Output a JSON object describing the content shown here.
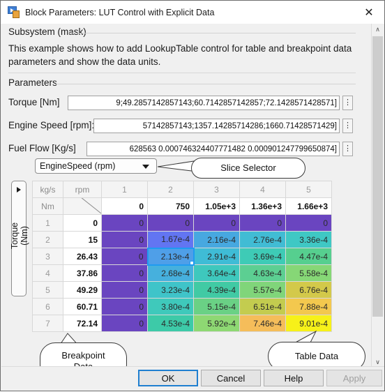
{
  "window": {
    "title": "Block Parameters: LUT Control with Explicit Data",
    "icon": "simulink-block-icon",
    "close_label": "✕"
  },
  "mask": {
    "type_label": "Subsystem (mask)",
    "description": "This example shows how to add LookupTable control for table and breakpoint data  parameters and show the data units.",
    "parameters_heading": "Parameters"
  },
  "parameters": [
    {
      "label": "Torque [Nm]",
      "value": "9;49.2857142857143;60.7142857142857;72.1428571428571]",
      "menu_icon": "⋮"
    },
    {
      "label": "Engine Speed [rpm]:",
      "value": "57142857143;1357.14285714286;1660.71428571429]",
      "menu_icon": "⋮"
    },
    {
      "label": "Fuel Flow [Kg/s]",
      "value": "628563 0.000746324407771482 0.000901247799650874]",
      "menu_icon": "⋮"
    }
  ],
  "slice_selector": {
    "value": "EngineSpeed (rpm)",
    "caret_icon": "chevron-down-icon"
  },
  "table": {
    "side_label": "Torque (Nm)",
    "side_caret_icon": "chevron-right-icon",
    "corner_col_unit": "kg/s",
    "corner_bp_unit": "rpm",
    "corner_row_unit": "Nm",
    "column_indices": [
      "1",
      "2",
      "3",
      "4",
      "5"
    ],
    "column_breakpoints": [
      "0",
      "750",
      "1.05e+3",
      "1.36e+3",
      "1.66e+3"
    ],
    "row_indices": [
      "1",
      "2",
      "3",
      "4",
      "5",
      "6",
      "7"
    ],
    "row_breakpoints": [
      "0",
      "15",
      "26.43",
      "37.86",
      "49.29",
      "60.71",
      "72.14"
    ],
    "selected_cell": {
      "row": 2,
      "col": 1
    },
    "cells": [
      [
        "0",
        "0",
        "0",
        "0",
        "0"
      ],
      [
        "0",
        "1.67e-4",
        "2.16e-4",
        "2.76e-4",
        "3.36e-4"
      ],
      [
        "0",
        "2.13e-4",
        "2.91e-4",
        "3.69e-4",
        "4.47e-4"
      ],
      [
        "0",
        "2.68e-4",
        "3.64e-4",
        "4.63e-4",
        "5.58e-4"
      ],
      [
        "0",
        "3.23e-4",
        "4.39e-4",
        "5.57e-4",
        "6.76e-4"
      ],
      [
        "0",
        "3.80e-4",
        "5.15e-4",
        "6.51e-4",
        "7.88e-4"
      ],
      [
        "0",
        "4.53e-4",
        "5.92e-4",
        "7.46e-4",
        "9.01e-4"
      ]
    ],
    "cell_colors": [
      [
        "#6a45c0",
        "#6a45c0",
        "#6a45c0",
        "#6a45c0",
        "#6a45c0"
      ],
      [
        "#6a45c0",
        "#6275f2",
        "#47a8e0",
        "#41bcd4",
        "#3fc8c4"
      ],
      [
        "#6a45c0",
        "#4f9fe8",
        "#3fbcd6",
        "#3ecbb6",
        "#56cf8f"
      ],
      [
        "#6a45c0",
        "#46b0dd",
        "#3ec8bd",
        "#5ccf92",
        "#86d776"
      ],
      [
        "#6a45c0",
        "#3fc4c9",
        "#41caa4",
        "#80d57a",
        "#d3c94a"
      ],
      [
        "#6a45c0",
        "#3fc9bb",
        "#6ad185",
        "#c3cc4f",
        "#f5c council"
      ],
      [
        "#6a45c0",
        "#3dcaa8",
        "#8ed873",
        "#f5bd5a",
        "#f7f119"
      ]
    ],
    "sel_handle_icon": "resize-handle"
  },
  "callouts": [
    {
      "text": "Slice Selector",
      "name": "callout-slice-selector"
    },
    {
      "text": "Breakpoint\nData",
      "name": "callout-breakpoint-data"
    },
    {
      "text": "Table Data",
      "name": "callout-table-data"
    }
  ],
  "scrollbar": {
    "up_icon": "∧",
    "down_icon": "∨"
  },
  "footer": {
    "buttons": [
      {
        "label": "OK",
        "state": "focused"
      },
      {
        "label": "Cancel",
        "state": "normal"
      },
      {
        "label": "Help",
        "state": "normal"
      },
      {
        "label": "Apply",
        "state": "disabled"
      }
    ]
  },
  "colors": {
    "accent": "#1f7fd0",
    "selection": "#1f9bf0"
  }
}
